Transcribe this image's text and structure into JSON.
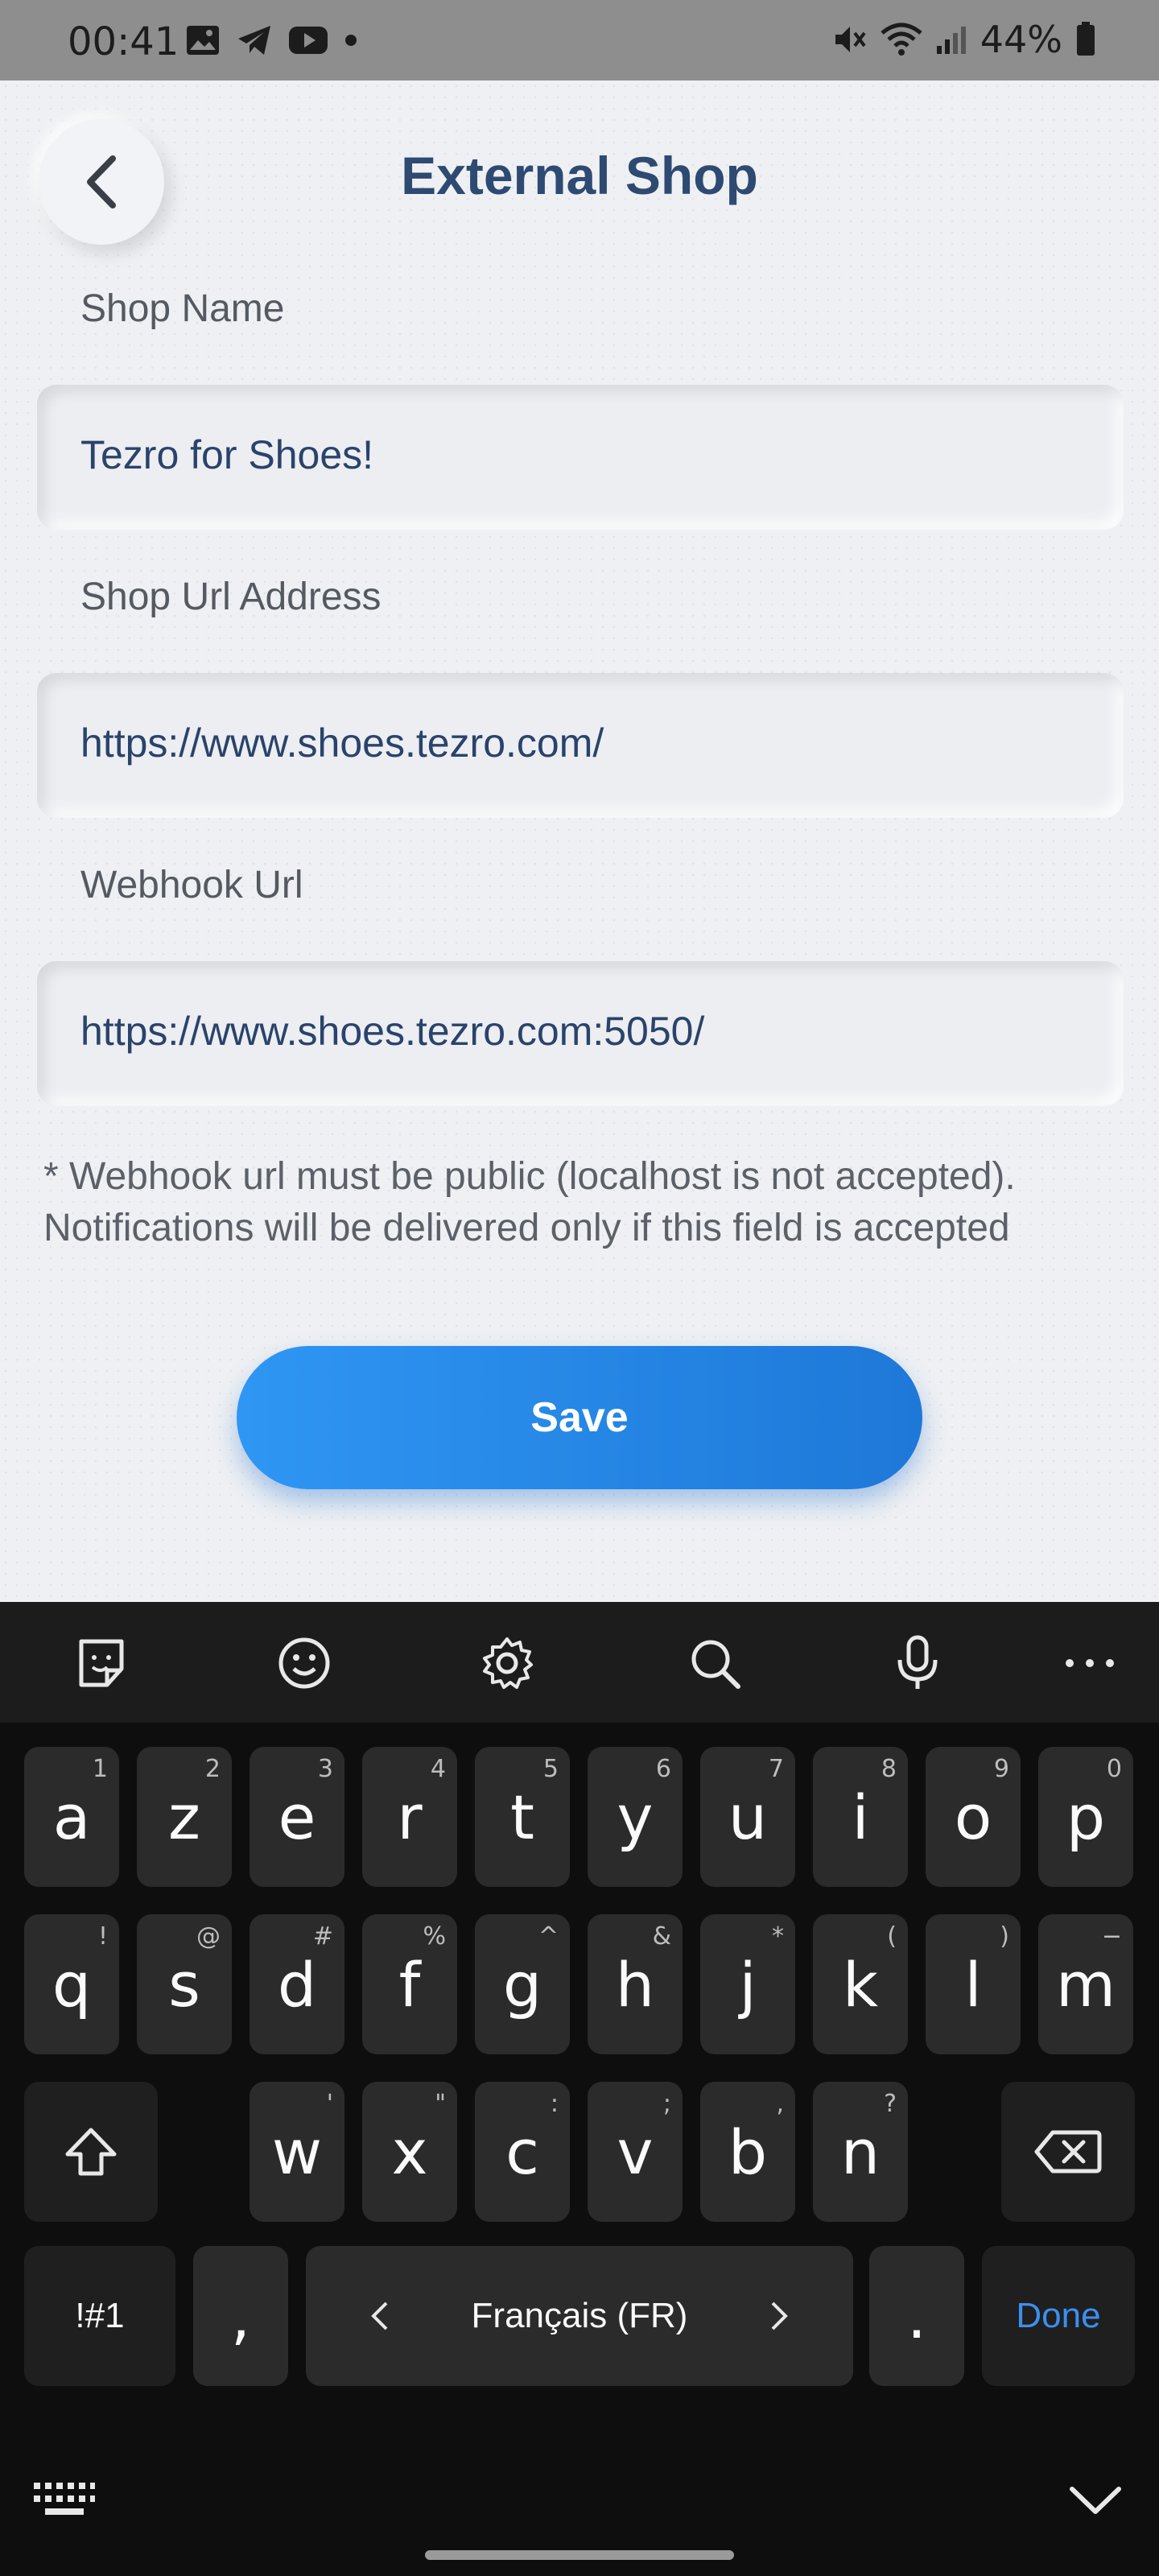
{
  "status": {
    "time": "00:41",
    "battery": "44%"
  },
  "page": {
    "title": "External Shop"
  },
  "form": {
    "shop_name_label": "Shop Name",
    "shop_name_value": "Tezro for Shoes!",
    "shop_url_label": "Shop Url Address",
    "shop_url_value": "https://www.shoes.tezro.com/",
    "webhook_label": "Webhook Url",
    "webhook_value": "https://www.shoes.tezro.com:5050/",
    "note_line1": "* Webhook url must be public (localhost is not accepted).",
    "note_line2": "Notifications will be delivered only if this field is accepted",
    "save_label": "Save"
  },
  "keyboard": {
    "row1": [
      {
        "k": "a",
        "h": "1"
      },
      {
        "k": "z",
        "h": "2"
      },
      {
        "k": "e",
        "h": "3"
      },
      {
        "k": "r",
        "h": "4"
      },
      {
        "k": "t",
        "h": "5"
      },
      {
        "k": "y",
        "h": "6"
      },
      {
        "k": "u",
        "h": "7"
      },
      {
        "k": "i",
        "h": "8"
      },
      {
        "k": "o",
        "h": "9"
      },
      {
        "k": "p",
        "h": "0"
      }
    ],
    "row2": [
      {
        "k": "q",
        "h": "!"
      },
      {
        "k": "s",
        "h": "@"
      },
      {
        "k": "d",
        "h": "#"
      },
      {
        "k": "f",
        "h": "%"
      },
      {
        "k": "g",
        "h": "^"
      },
      {
        "k": "h",
        "h": "&"
      },
      {
        "k": "j",
        "h": "*"
      },
      {
        "k": "k",
        "h": "("
      },
      {
        "k": "l",
        "h": ")"
      },
      {
        "k": "m",
        "h": "−"
      }
    ],
    "row3": [
      {
        "k": "w",
        "h": "'"
      },
      {
        "k": "x",
        "h": "\""
      },
      {
        "k": "c",
        "h": ":"
      },
      {
        "k": "v",
        "h": ";"
      },
      {
        "k": "b",
        "h": ","
      },
      {
        "k": "n",
        "h": "?"
      }
    ],
    "symbols_label": "!#1",
    "comma_label": ",",
    "language_label": "Français (FR)",
    "period_label": ".",
    "done_label": "Done"
  },
  "colors": {
    "accent": "#1e78d8",
    "title": "#2e4a72",
    "done": "#3c8ff0"
  }
}
